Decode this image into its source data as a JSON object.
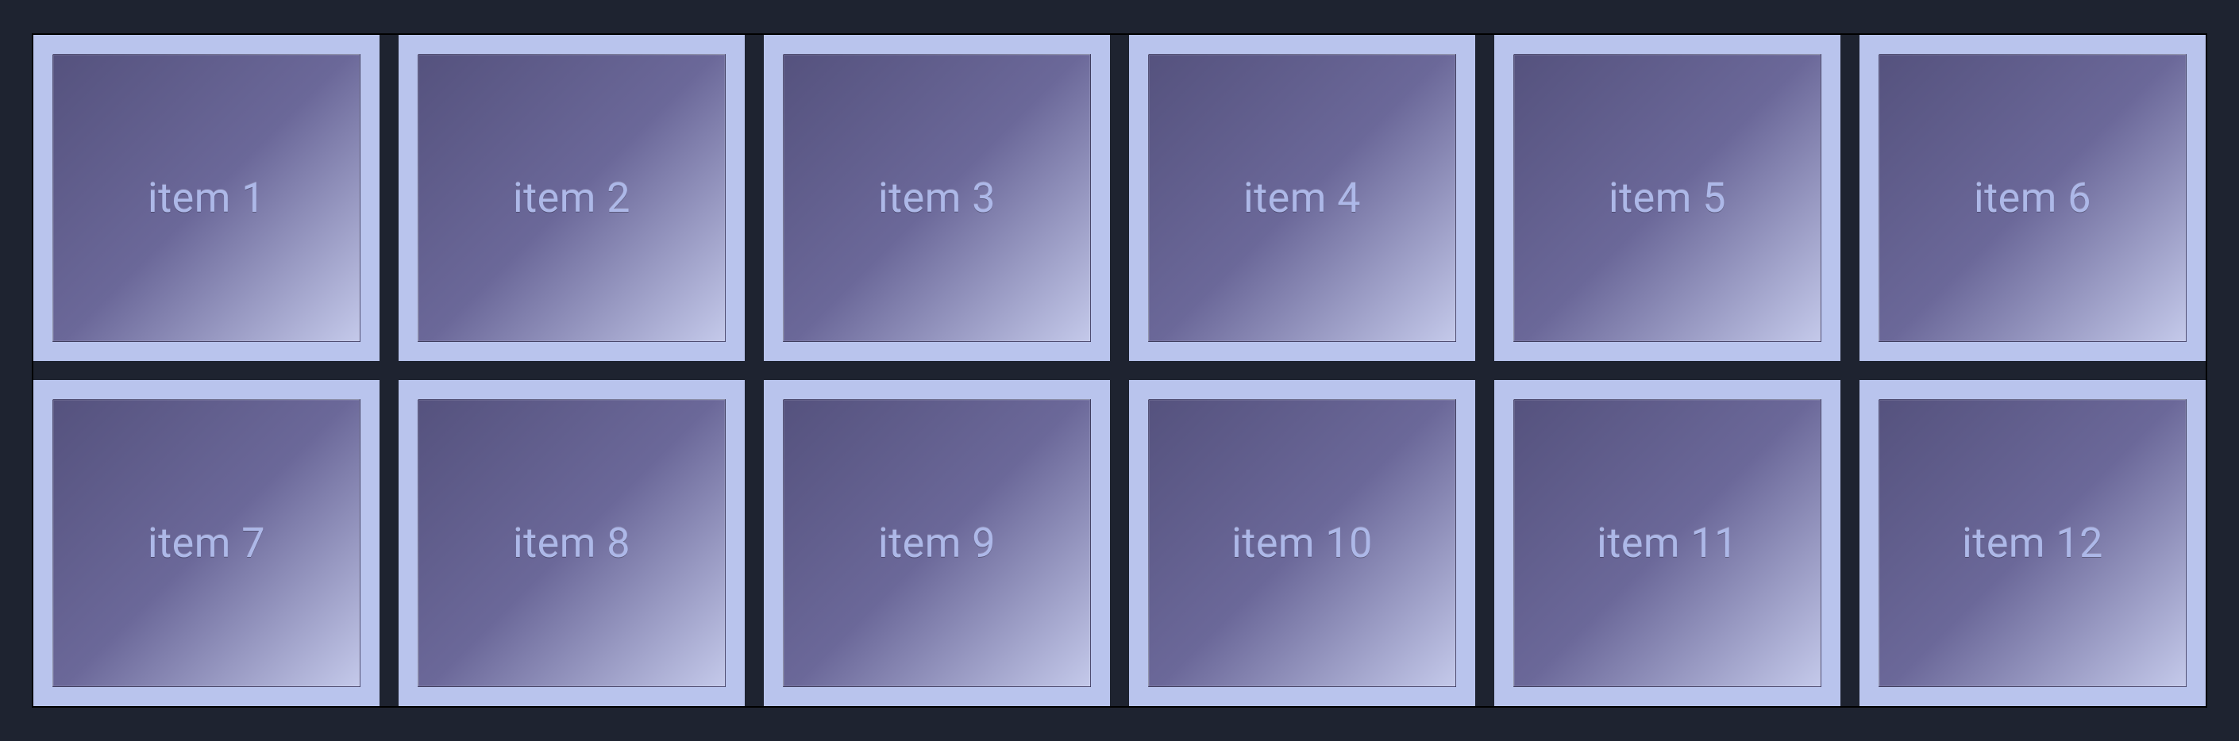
{
  "grid": {
    "columns": 6,
    "rows": 2,
    "items": [
      {
        "label": "item 1"
      },
      {
        "label": "item 2"
      },
      {
        "label": "item 3"
      },
      {
        "label": "item 4"
      },
      {
        "label": "item 5"
      },
      {
        "label": "item 6"
      },
      {
        "label": "item 7"
      },
      {
        "label": "item 8"
      },
      {
        "label": "item 9"
      },
      {
        "label": "item 10"
      },
      {
        "label": "item 11"
      },
      {
        "label": "item 12"
      }
    ]
  },
  "colors": {
    "page_bg": "#1e2330",
    "item_border": "#b9c4ed",
    "item_gradient_start": "#55527e",
    "item_gradient_end": "#c4c9ea",
    "label_color": "#adb8e8"
  }
}
